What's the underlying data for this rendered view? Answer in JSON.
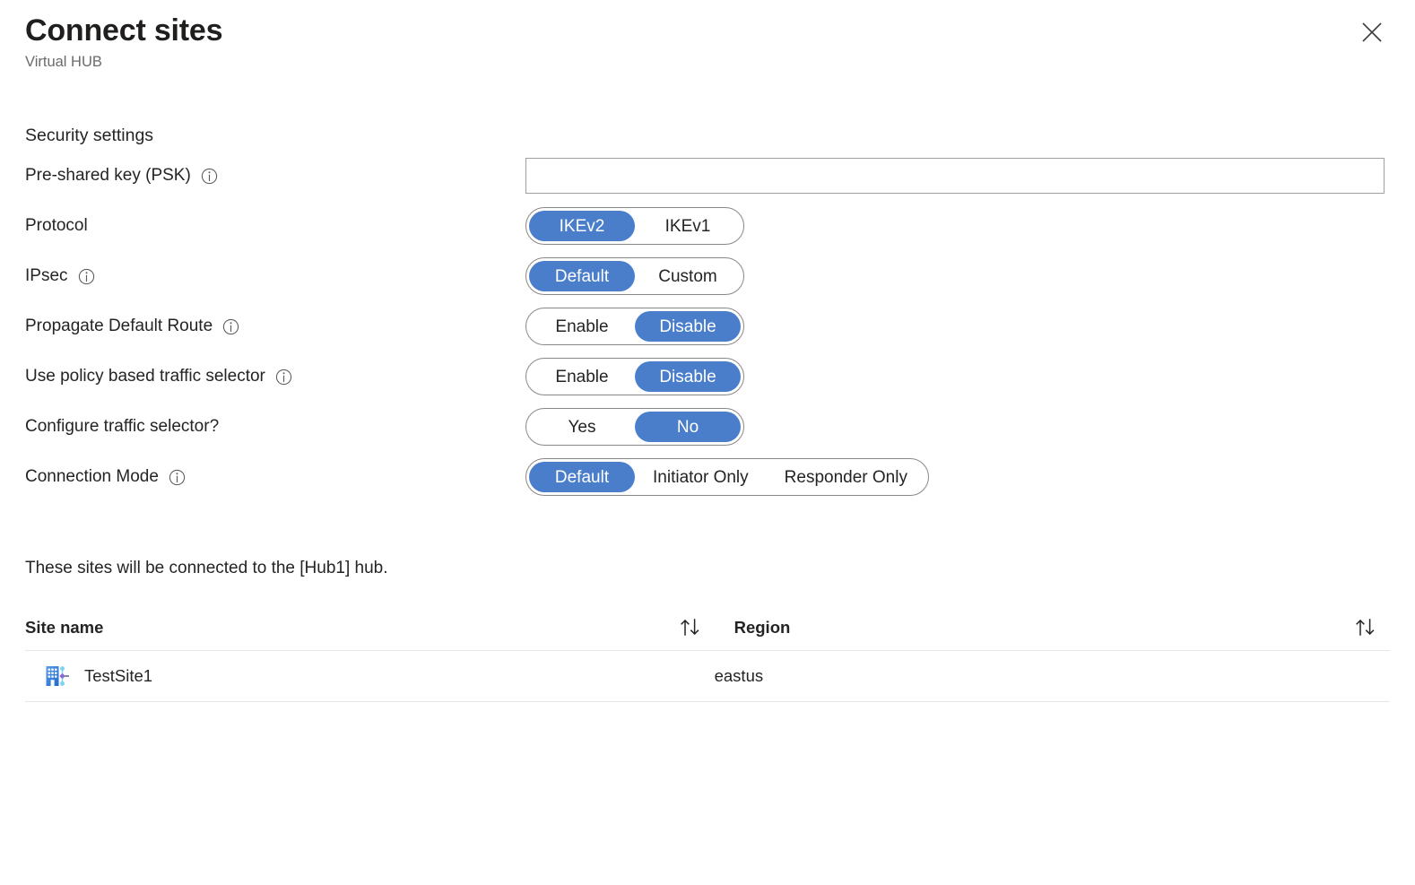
{
  "header": {
    "title": "Connect sites",
    "subtitle": "Virtual HUB",
    "close_label": "Close",
    "close_icon": "close-icon"
  },
  "colors": {
    "accent_blue": "#4a7ecb",
    "text": "#242424",
    "subtitle": "#6a6a6a",
    "border": "#8a8886",
    "input_border": "#a19f9d",
    "table_divider": "#e6e6e6"
  },
  "form": {
    "section_heading": "Security settings",
    "psk": {
      "label": "Pre-shared key (PSK)",
      "info_icon": "info-icon",
      "value": "",
      "placeholder": ""
    },
    "protocol": {
      "label": "Protocol",
      "has_info": false,
      "options": [
        "IKEv2",
        "IKEv1"
      ],
      "selected": "IKEv2"
    },
    "ipsec": {
      "label": "IPsec",
      "has_info": true,
      "info_icon": "info-icon",
      "options": [
        "Default",
        "Custom"
      ],
      "selected": "Default"
    },
    "propagate_default_route": {
      "label": "Propagate Default Route",
      "has_info": true,
      "info_icon": "info-icon",
      "options": [
        "Enable",
        "Disable"
      ],
      "selected": "Disable"
    },
    "policy_based_traffic_selector": {
      "label": "Use policy based traffic selector",
      "has_info": true,
      "info_icon": "info-icon",
      "options": [
        "Enable",
        "Disable"
      ],
      "selected": "Disable"
    },
    "configure_traffic_selector": {
      "label": "Configure traffic selector?",
      "has_info": false,
      "options": [
        "Yes",
        "No"
      ],
      "selected": "No"
    },
    "connection_mode": {
      "label": "Connection Mode",
      "has_info": true,
      "info_icon": "info-icon",
      "options": [
        "Default",
        "Initiator Only",
        "Responder Only"
      ],
      "selected": "Default"
    }
  },
  "sites": {
    "note": "These sites will be connected to the [Hub1] hub.",
    "columns": [
      {
        "label": "Site name",
        "sort_icon": "sort-updown-icon"
      },
      {
        "label": "Region",
        "sort_icon": "sort-updown-icon"
      }
    ],
    "rows": [
      {
        "name": "TestSite1",
        "region": "eastus",
        "icon": "vpn-site-icon"
      }
    ]
  }
}
